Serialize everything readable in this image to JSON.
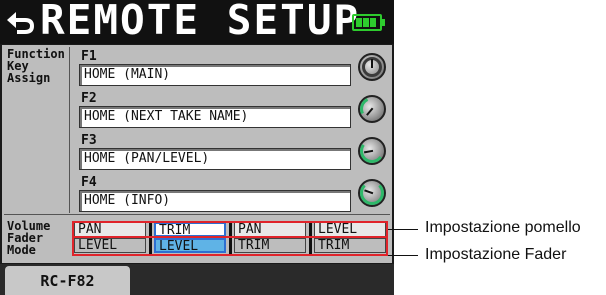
{
  "header": {
    "title": "REMOTE SETUP",
    "back_icon": "back-arrow-icon",
    "battery_icon": "battery-icon",
    "battery_color": "#2ecc2e"
  },
  "function_key_assign": {
    "label": "Function\nKey\nAssign",
    "rows": [
      {
        "key": "F1",
        "value": "HOME (MAIN)"
      },
      {
        "key": "F2",
        "value": "HOME (NEXT TAKE NAME)"
      },
      {
        "key": "F3",
        "value": "HOME (PAN/LEVEL)"
      },
      {
        "key": "F4",
        "value": "HOME (INFO)"
      }
    ]
  },
  "volume_fader_mode": {
    "label": "Volume\nFader\nMode",
    "options": [
      {
        "knob": "PAN",
        "fader": "LEVEL",
        "selected": false
      },
      {
        "knob": "TRIM",
        "fader": "LEVEL",
        "selected": true
      },
      {
        "knob": "PAN",
        "fader": "TRIM",
        "selected": false
      },
      {
        "knob": "LEVEL",
        "fader": "TRIM",
        "selected": false
      }
    ],
    "selected_color": "#5fb3e6"
  },
  "tabs": [
    {
      "label": "RC-F82"
    }
  ],
  "annotations": {
    "knob_setting": "Impostazione pomello",
    "fader_setting": "Impostazione Fader",
    "highlight_color": "#e0242b"
  }
}
